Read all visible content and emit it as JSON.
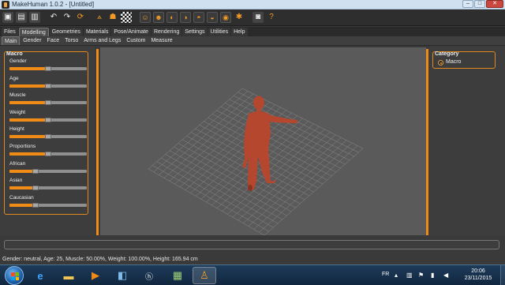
{
  "window": {
    "title": "MakeHuman 1.0.2 - [Untitled]",
    "minimize_label": "–",
    "maximize_label": "□",
    "close_label": "✕"
  },
  "toolbar": {
    "icons": [
      "save-icon",
      "save-as-icon",
      "export-icon",
      "undo-icon",
      "redo-icon",
      "reset-icon",
      "wireframe-icon",
      "skeleton-icon",
      "grid-icon",
      "front-view-icon",
      "back-view-icon",
      "left-view-icon",
      "right-view-icon",
      "top-view-icon",
      "bottom-view-icon",
      "reset-camera-icon",
      "pose-icon",
      "screenshot-icon",
      "help-icon"
    ]
  },
  "menu": {
    "tabs": [
      "Files",
      "Modelling",
      "Geometries",
      "Materials",
      "Pose/Animate",
      "Rendering",
      "Settings",
      "Utilities",
      "Help"
    ],
    "active": "Modelling"
  },
  "submenu": {
    "tabs": [
      "Main",
      "Gender",
      "Face",
      "Torso",
      "Arms and Legs",
      "Custom",
      "Measure"
    ],
    "active": "Main"
  },
  "macro": {
    "title": "Macro",
    "sliders": [
      {
        "label": "Gender",
        "value": 0.5
      },
      {
        "label": "Age",
        "value": 0.5
      },
      {
        "label": "Muscle",
        "value": 0.5
      },
      {
        "label": "Weight",
        "value": 0.5
      },
      {
        "label": "Height",
        "value": 0.5
      },
      {
        "label": "Proportions",
        "value": 0.5
      },
      {
        "label": "African",
        "value": 0.333
      },
      {
        "label": "Asian",
        "value": 0.333
      },
      {
        "label": "Caucasian",
        "value": 0.333
      }
    ]
  },
  "category": {
    "title": "Category",
    "option": "Macro"
  },
  "status": {
    "text": "Gender: neutral, Age: 25, Muscle: 50.00%, Weight: 100.00%, Height: 165.94 cm"
  },
  "taskbar": {
    "language": "FR",
    "time": "20:06",
    "date": "23/11/2015",
    "apps": [
      "ie-icon",
      "explorer-icon",
      "media-player-icon",
      "switcher-icon",
      "hp-icon",
      "image-viewer-icon",
      "makehuman-icon"
    ]
  },
  "colors": {
    "accent": "#f08b16",
    "figure": "#b5472f",
    "viewport": "#5a5a5a"
  }
}
